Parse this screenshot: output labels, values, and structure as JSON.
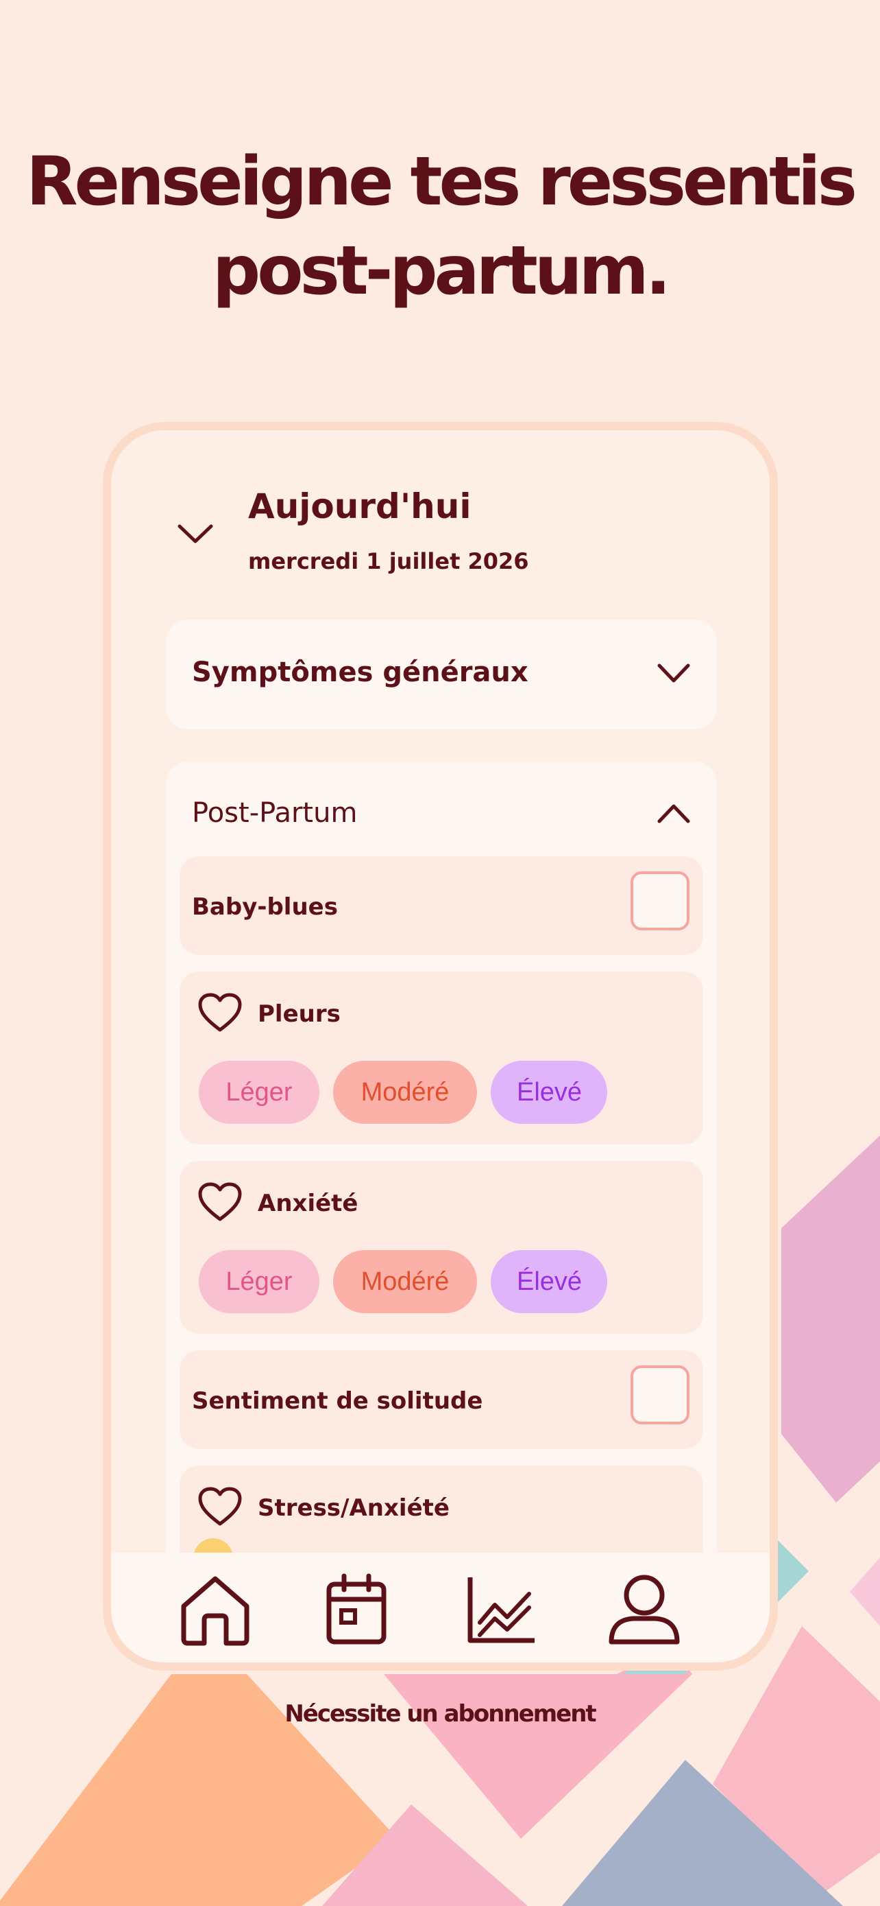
{
  "headline": {
    "line1": "Renseigne tes ressentis",
    "line2": "post-partum."
  },
  "date": {
    "title": "Aujourd'hui",
    "subtitle": "mercredi 1 juillet 2026"
  },
  "sections": {
    "general": {
      "title": "Symptômes généraux"
    },
    "postpartum": {
      "title": "Post-Partum",
      "items": [
        {
          "label": "Baby-blues",
          "kind": "checkbox",
          "checked": false
        },
        {
          "label": "Pleurs",
          "kind": "intensity",
          "options": [
            "Léger",
            "Modéré",
            "Élevé"
          ]
        },
        {
          "label": "Anxiété",
          "kind": "intensity",
          "options": [
            "Léger",
            "Modéré",
            "Élevé"
          ]
        },
        {
          "label": "Sentiment de solitude",
          "kind": "checkbox",
          "checked": false
        },
        {
          "label": "Stress/Anxiété",
          "kind": "slider",
          "value": 0
        }
      ]
    }
  },
  "tabs": [
    {
      "icon": "home-icon"
    },
    {
      "icon": "calendar-icon"
    },
    {
      "icon": "chart-icon"
    },
    {
      "icon": "profile-icon"
    }
  ],
  "footer": {
    "text": "Nécessite un abonnement"
  },
  "colors": {
    "background": "#fdeae0",
    "primary": "#5c1119",
    "card": "#fdf6f1",
    "item": "#fdeae2",
    "slider": "#f58620"
  }
}
